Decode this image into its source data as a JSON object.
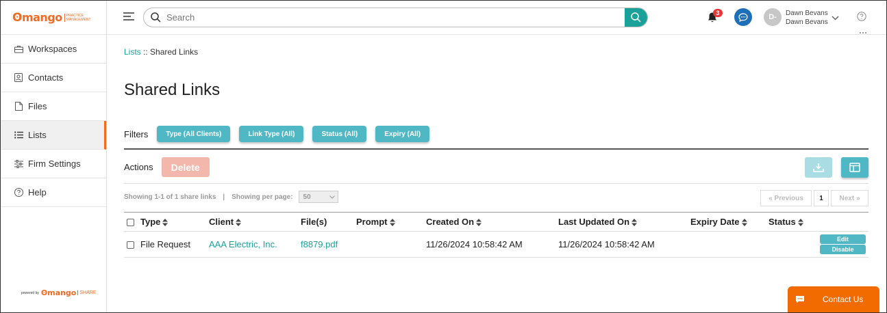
{
  "app": {
    "logo_text": "mango",
    "logo_sub_line1": "PRACTICE",
    "logo_sub_line2": "MANAGEMENT",
    "powered_by": "powered by",
    "powered_brand": "mango",
    "powered_product": "SHARE",
    "brand_color": "#f26b21",
    "accent_color": "#4fb8c4"
  },
  "sidebar": {
    "items": [
      {
        "label": "Workspaces",
        "icon": "briefcase-icon"
      },
      {
        "label": "Contacts",
        "icon": "contact-card-icon"
      },
      {
        "label": "Files",
        "icon": "file-icon"
      },
      {
        "label": "Lists",
        "icon": "list-icon",
        "active": true
      },
      {
        "label": "Firm Settings",
        "icon": "sliders-icon"
      },
      {
        "label": "Help",
        "icon": "help-circle-icon"
      }
    ]
  },
  "header": {
    "search_placeholder": "Search",
    "notification_count": "3",
    "avatar_initials": "D-",
    "user_name": "Dawn Bevans",
    "user_firm": "Dawn Bevans"
  },
  "breadcrumb": {
    "parent": "Lists",
    "separator": " :: ",
    "current": "Shared Links"
  },
  "page_title": "Shared Links",
  "filters": {
    "label": "Filters",
    "buttons": [
      "Type (All Clients)",
      "Link Type (All)",
      "Status (All)",
      "Expiry (All)"
    ]
  },
  "actions": {
    "label": "Actions",
    "delete_label": "Delete"
  },
  "listing": {
    "showing_text": "Showing 1-1 of 1 share links",
    "separator": "|",
    "per_page_label": "Showing per page:",
    "per_page_value": "50",
    "prev_label": "« Previous",
    "page_number": "1",
    "next_label": "Next »"
  },
  "table": {
    "columns": [
      "Type",
      "Client",
      "File(s)",
      "Prompt",
      "Created On",
      "Last Updated On",
      "Expiry Date",
      "Status"
    ],
    "rows": [
      {
        "type": "File Request",
        "client": "AAA Electric, Inc.",
        "files": "f8879.pdf",
        "prompt": "",
        "created_on": "11/26/2024 10:58:42 AM",
        "last_updated_on": "11/26/2024 10:58:42 AM",
        "expiry_date": "",
        "status": "",
        "edit_label": "Edit",
        "disable_label": "Disable"
      }
    ]
  },
  "contact_us": "Contact Us"
}
